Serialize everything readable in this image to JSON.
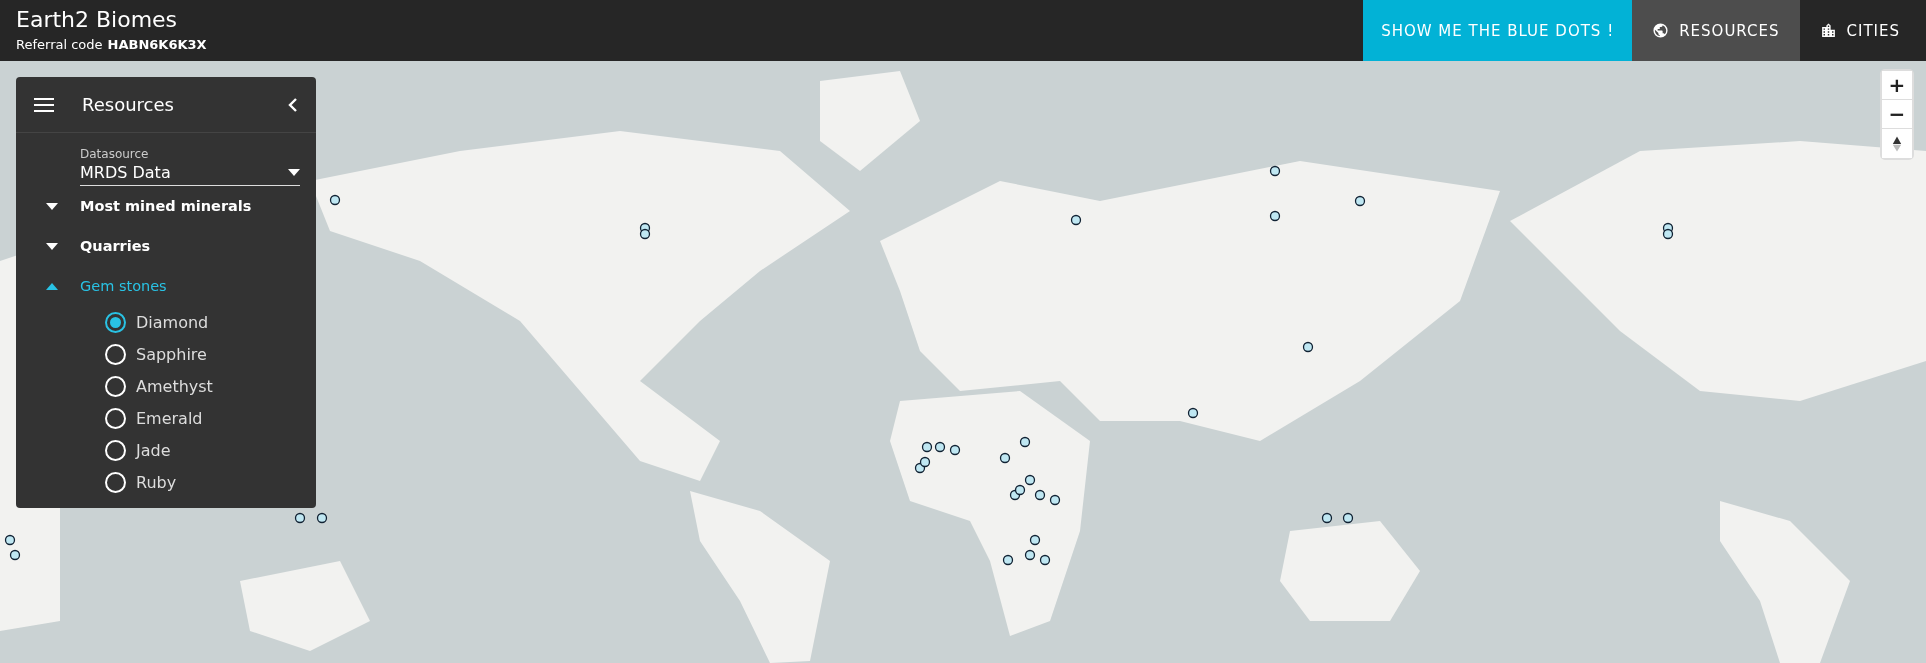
{
  "header": {
    "title": "Earth2 Biomes",
    "referral_label": "Referral code",
    "referral_code": "HABN6K6K3X"
  },
  "nav": [
    {
      "kind": "action",
      "label": "SHOW ME THE BLUE DOTS !"
    },
    {
      "kind": "resources",
      "label": "RESOURCES",
      "selected": true
    },
    {
      "kind": "cities",
      "label": "CITIES",
      "selected": false
    }
  ],
  "zoom_controls": [
    {
      "kind": "zoom-in",
      "label": "+"
    },
    {
      "kind": "zoom-out",
      "label": "−"
    },
    {
      "kind": "compass"
    }
  ],
  "panel": {
    "title": "Resources",
    "datasource": {
      "label": "Datasource",
      "value": "MRDS Data"
    },
    "sections": [
      {
        "label": "Most mined minerals",
        "expanded": false
      },
      {
        "label": "Quarries",
        "expanded": false
      },
      {
        "label": "Gem stones",
        "expanded": true,
        "options": [
          {
            "label": "Diamond",
            "selected": true
          },
          {
            "label": "Sapphire",
            "selected": false
          },
          {
            "label": "Amethyst",
            "selected": false
          },
          {
            "label": "Emerald",
            "selected": false
          },
          {
            "label": "Jade",
            "selected": false
          },
          {
            "label": "Ruby",
            "selected": false
          }
        ]
      }
    ]
  }
}
